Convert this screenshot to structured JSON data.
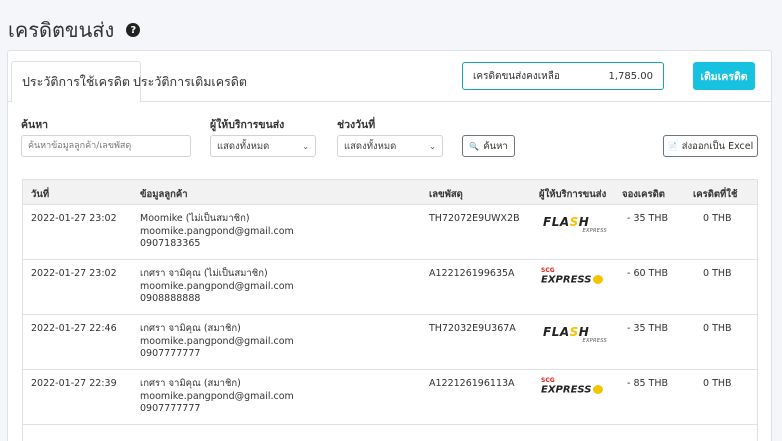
{
  "page": {
    "title": "เครดิตขนส่ง"
  },
  "tabs": [
    {
      "label": "ประวัติการใช้เครดิต",
      "active": true
    },
    {
      "label": "ประวัติการเติมเครดิต",
      "active": false
    }
  ],
  "credit": {
    "label": "เครดิตขนส่งคงเหลือ",
    "amount": "1,785.00"
  },
  "topup_button": "เติมเครดิต",
  "filters": {
    "search_label": "ค้นหา",
    "search_placeholder": "ค้นหาข้อมูลลูกค้า/เลขพัสดุ",
    "carrier_label": "ผู้ให้บริการขนส่ง",
    "carrier_value": "แสดงทั้งหมด",
    "date_label": "ช่วงวันที่",
    "date_value": "แสดงทั้งหมด",
    "search_button": "ค้นหา",
    "export_button": "ส่งออกเป็น Excel"
  },
  "table": {
    "headers": {
      "date": "วันที่",
      "customer": "ข้อมูลลูกค้า",
      "tracking": "เลขพัสดุ",
      "carrier": "ผู้ให้บริการขนส่ง",
      "reserved": "จองเครดิต",
      "used": "เครดิตที่ใช้"
    },
    "rows": [
      {
        "date": "2022-01-27 23:02",
        "name": "Moomike  (ไม่เป็นสมาชิก)",
        "email": "moomike.pangpond@gmail.com",
        "phone": "0907183365",
        "tracking": "TH72072E9UWX2B",
        "carrier": "flash",
        "reserved": "- 35 THB",
        "used": "0 THB"
      },
      {
        "date": "2022-01-27 23:02",
        "name": "เกศรา จามิคุณ  (ไม่เป็นสมาชิก)",
        "email": "moomike.pangpond@gmail.com",
        "phone": "0908888888",
        "tracking": "A122126199635A",
        "carrier": "scg",
        "reserved": "- 60 THB",
        "used": "0 THB"
      },
      {
        "date": "2022-01-27 22:46",
        "name": "เกศรา จามิคุณ  (สมาชิก)",
        "email": "moomike.pangpond@gmail.com",
        "phone": "0907777777",
        "tracking": "TH72032E9U367A",
        "carrier": "flash",
        "reserved": "- 35 THB",
        "used": "0 THB"
      },
      {
        "date": "2022-01-27 22:39",
        "name": "เกศรา จามิคุณ  (สมาชิก)",
        "email": "moomike.pangpond@gmail.com",
        "phone": "0907777777",
        "tracking": "A122126196113A",
        "carrier": "scg",
        "reserved": "- 85 THB",
        "used": "0 THB"
      }
    ]
  },
  "logos": {
    "flash": {
      "main_a": "FLA",
      "bolt": "S",
      "main_b": "H",
      "sub": "EXPRESS"
    },
    "scg": {
      "top": "SCG",
      "main": "EXPRESS"
    }
  },
  "icons": {
    "help": "?",
    "search": "🔍",
    "excel": "📄",
    "chevron": "⌄"
  }
}
